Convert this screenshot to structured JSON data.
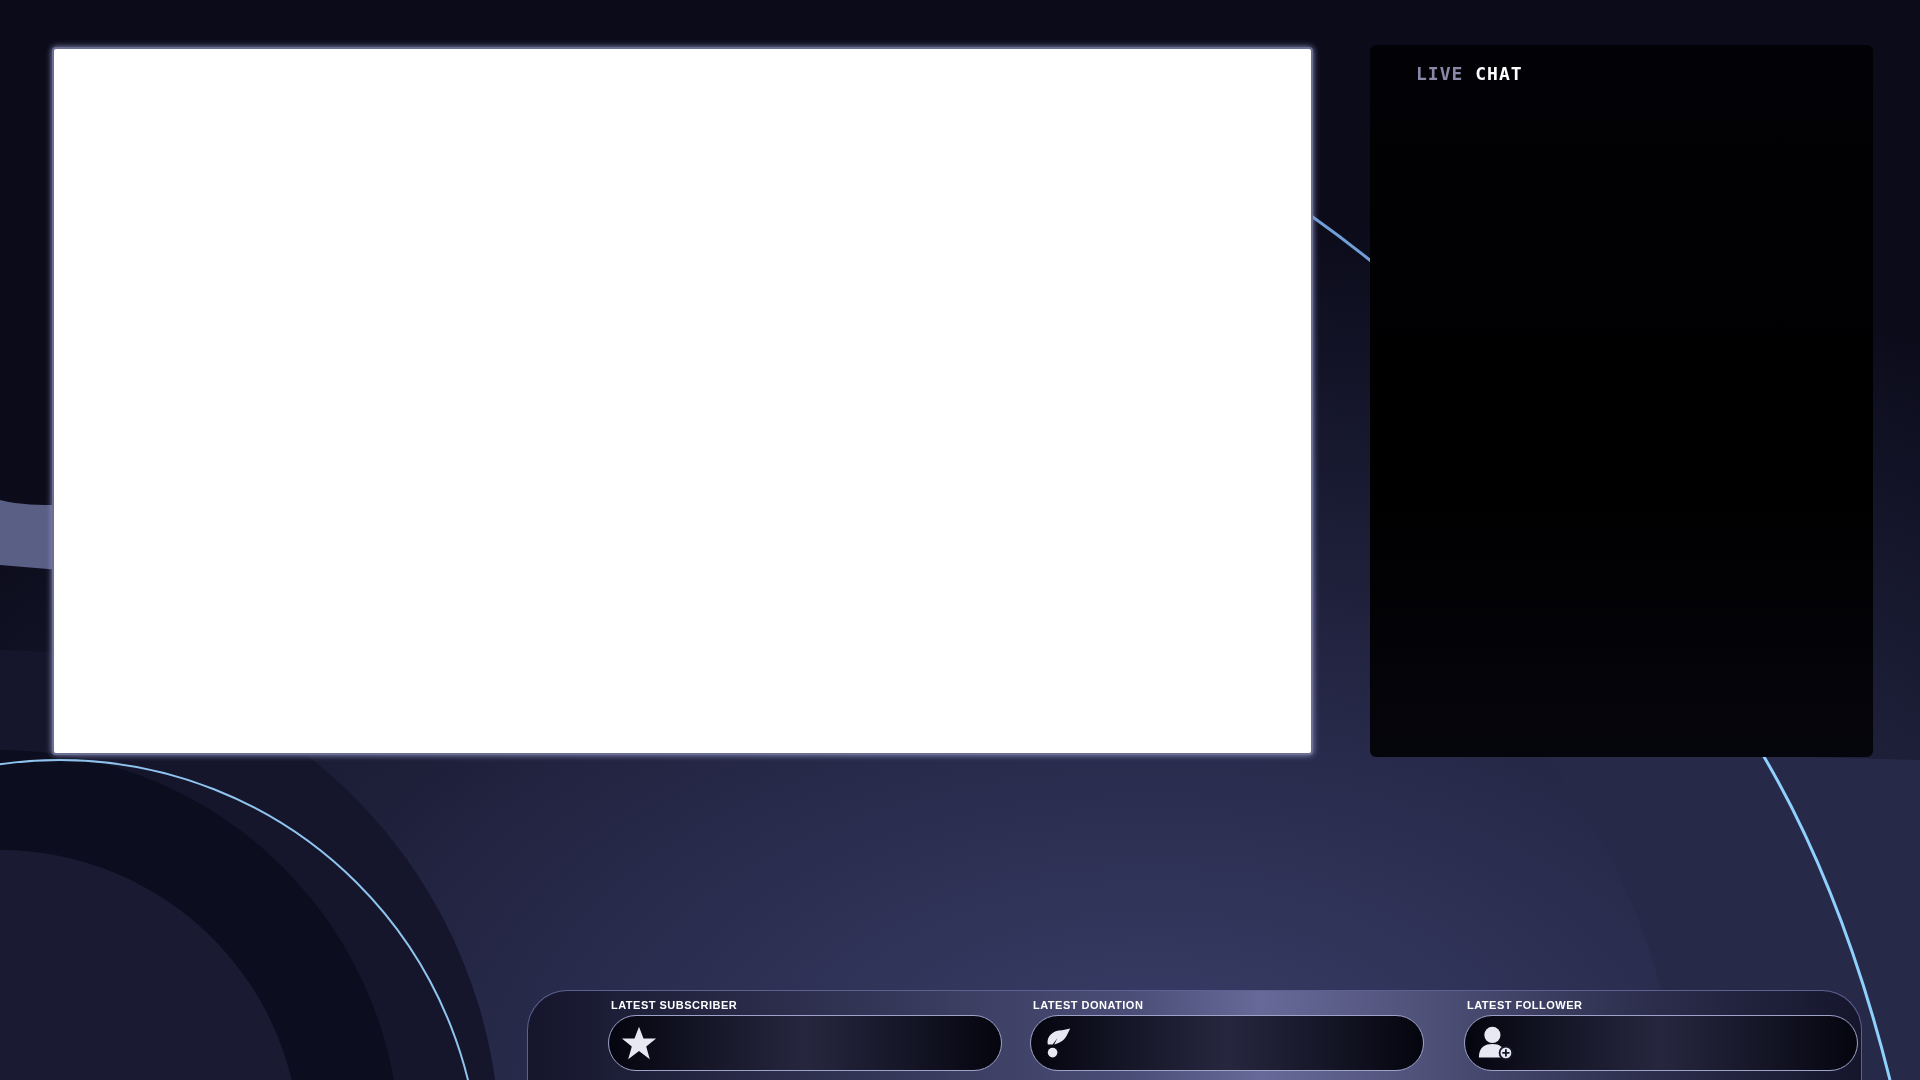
{
  "live_chat": {
    "title_words": [
      {
        "text": "LIVE",
        "muted": true
      },
      {
        "text": "CHAT",
        "muted": false
      }
    ]
  },
  "alerts": [
    {
      "label": "LATEST SUBSCRIBER",
      "kind": "star"
    },
    {
      "label": "LATEST DONATION",
      "kind": "donation"
    },
    {
      "label": "LATEST FOLLOWER",
      "kind": "follower"
    }
  ]
}
